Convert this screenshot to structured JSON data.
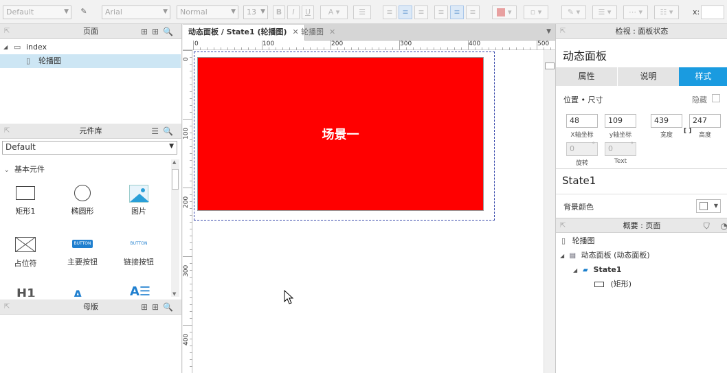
{
  "toolbar": {
    "style_select": "Default",
    "font_select": "Arial",
    "weight_select": "Normal",
    "size_select": "13",
    "bold": "B",
    "italic": "I",
    "underline": "U",
    "x_label": "x:"
  },
  "pages_panel": {
    "title": "页面",
    "items": [
      {
        "label": "index"
      },
      {
        "label": "轮播图"
      }
    ]
  },
  "library_panel": {
    "title": "元件库",
    "selected_library": "Default",
    "group": "基本元件",
    "items": [
      {
        "label": "矩形1"
      },
      {
        "label": "椭圆形"
      },
      {
        "label": "图片"
      },
      {
        "label": "占位符"
      },
      {
        "label": "主要按钮"
      },
      {
        "label": "链接按钮"
      }
    ],
    "button_text": "BUTTON",
    "h1_text": "H1"
  },
  "masters_panel": {
    "title": "母版"
  },
  "canvas": {
    "tabs": [
      {
        "label": "动态面板 / State1 (轮播图)"
      },
      {
        "label": "轮播图"
      }
    ],
    "ruler_top": [
      "0",
      "100",
      "200",
      "300",
      "400",
      "500"
    ],
    "ruler_left": [
      "0",
      "100",
      "200",
      "300",
      "400"
    ],
    "rect_text": "场景一",
    "rect_color": "#ff0000"
  },
  "inspector": {
    "title": "检视 : 面板状态",
    "name": "动态面板",
    "tabs": [
      {
        "label": "属性"
      },
      {
        "label": "说明"
      },
      {
        "label": "样式"
      }
    ],
    "section_label": "位置 • 尺寸",
    "hide_label": "隐藏",
    "x_value": "48",
    "x_label": "X轴坐标",
    "y_value": "109",
    "y_label": "y轴坐标",
    "w_value": "439",
    "w_label": "宽度",
    "h_value": "247",
    "h_label": "高度",
    "rotate_value": "0",
    "rotate_label": "旋转",
    "text_rotate_value": "0",
    "text_rotate_label": "Text",
    "state_name": "State1",
    "bg_color_label": "背景颜色",
    "accent": "#1a9be0"
  },
  "outline_panel": {
    "title": "概要 : 页面",
    "items": [
      {
        "label": "轮播图"
      },
      {
        "label": "动态面板 (动态面板)"
      },
      {
        "label": "State1"
      },
      {
        "label": "(矩形)"
      }
    ]
  }
}
